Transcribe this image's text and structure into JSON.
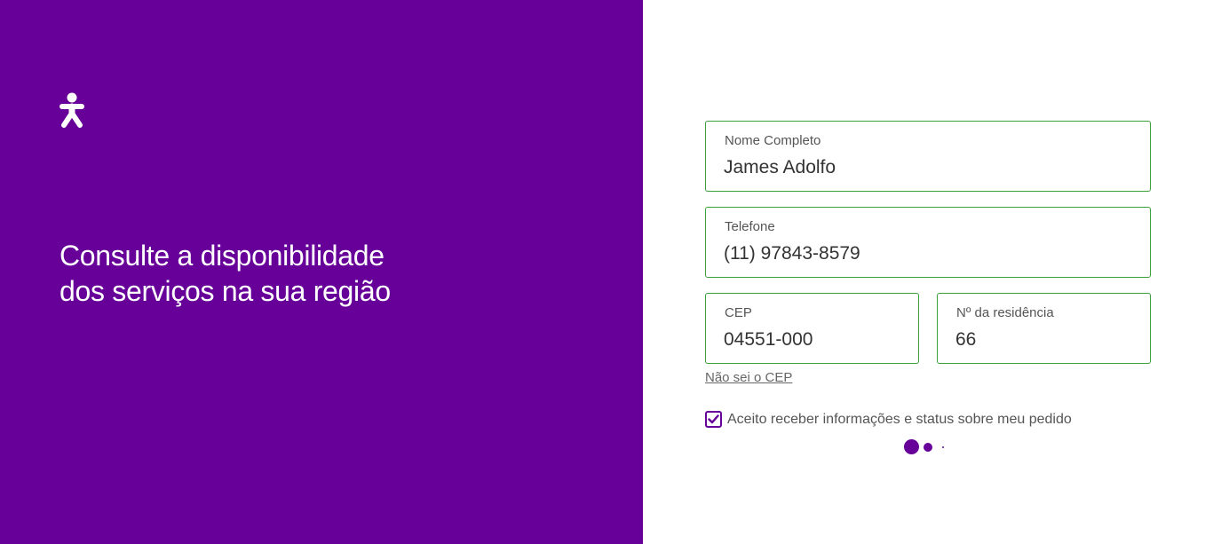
{
  "brand": {
    "logo_icon": "vivo-person-logo-icon",
    "primary_color": "#660099",
    "accent_border_color": "#39a03a"
  },
  "hero": {
    "headline_line1": "Consulte a disponibilidade",
    "headline_line2": "dos serviços na sua região"
  },
  "form": {
    "name": {
      "label": "Nome Completo",
      "value": "James Adolfo"
    },
    "phone": {
      "label": "Telefone",
      "value": "(11) 97843-8579"
    },
    "cep": {
      "label": "CEP",
      "value": "04551-000"
    },
    "house_number": {
      "label": "Nº da residência",
      "value": "66"
    },
    "cep_help_link": "Não sei o CEP",
    "consent": {
      "label": "Aceito receber informações e status sobre meu pedido",
      "checked": true
    }
  },
  "loading_indicator": {
    "icon": "loading-dots-icon"
  }
}
